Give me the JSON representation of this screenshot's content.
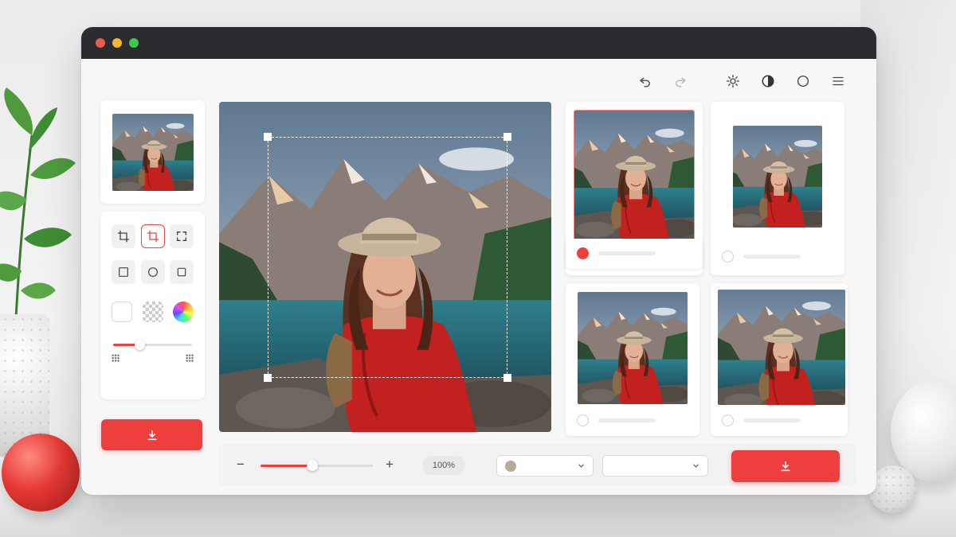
{
  "window": {
    "traffic_lights": [
      "#ee5a52",
      "#f5b731",
      "#3ec94a"
    ]
  },
  "toolbar": {
    "icons": [
      "undo-icon",
      "redo-icon",
      "brightness-icon",
      "contrast-icon",
      "circle-icon",
      "menu-icon"
    ]
  },
  "left_panel": {
    "crop_tools": [
      "crop-icon",
      "crop-active-icon",
      "crop-free-icon"
    ],
    "shape_tools": [
      "square-shape-icon",
      "circle-shape-icon",
      "rect-shape-icon"
    ],
    "backgrounds": [
      "white-swatch",
      "transparent-swatch",
      "color-wheel-swatch"
    ],
    "slider_level": 0.33
  },
  "zoom": {
    "minus": "−",
    "plus": "+",
    "value": "100%",
    "level": 0.46
  },
  "bottom": {
    "dropdown_1_color": "#b8a898"
  },
  "colors": {
    "accent": "#ef3e3e"
  }
}
